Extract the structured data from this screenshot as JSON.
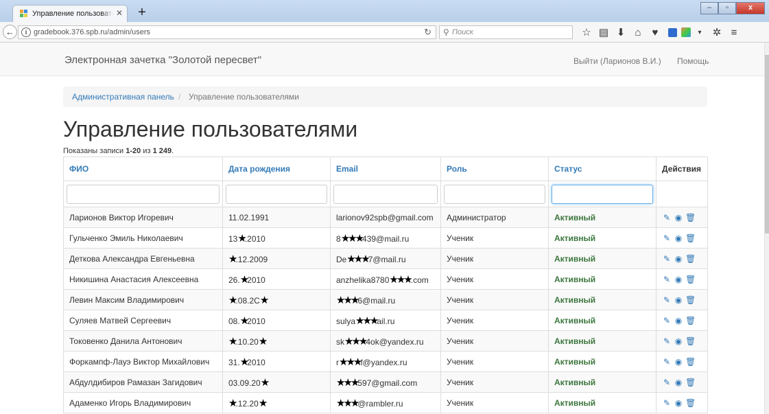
{
  "browser": {
    "tab_title": "Управление пользователям",
    "url": "gradebook.376.spb.ru/admin/users",
    "search_placeholder": "Поиск"
  },
  "app": {
    "brand": "Электронная зачетка \"Золотой пересвет\"",
    "logout": "Выйти (Ларионов В.И.)",
    "help": "Помощь"
  },
  "breadcrumb": {
    "parent": "Административная панель",
    "separator": "/",
    "current": "Управление пользователями"
  },
  "page": {
    "title": "Управление пользователями",
    "summary_prefix": "Показаны записи",
    "summary_range": "1-20",
    "summary_of": "из",
    "summary_total": "1 249",
    "summary_end": "."
  },
  "table": {
    "headers": [
      "ФИО",
      "Дата рождения",
      "Email",
      "Роль",
      "Статус",
      "Действия"
    ],
    "rows": [
      [
        "Ларионов Виктор Игоревич",
        "11.02.1991",
        "larionov92spb@gmail.com",
        "Администратор",
        "Активный"
      ],
      [
        "Гульченко Эмиль Николаевич",
        "13★.2010",
        "8★★★439@mail.ru",
        "Ученик",
        "Активный"
      ],
      [
        "Деткова Александра Евгеньевна",
        "★.12.2009",
        "De★★★7@mail.ru",
        "Ученик",
        "Активный"
      ],
      [
        "Никишина Анастасия Алексеевна",
        "26.★2010",
        "anzhelika8780★★★.com",
        "Ученик",
        "Активный"
      ],
      [
        "Левин Максим Владимирович",
        "★.08.2C★",
        "★★★6@mail.ru",
        "Ученик",
        "Активный"
      ],
      [
        "Суляев Матвей Сергеевич",
        "08.★2010",
        "sulya★★★ail.ru",
        "Ученик",
        "Активный"
      ],
      [
        "Токовенко Данила Антонович",
        "★.10.20★",
        "sk★★★4ok@yandex.ru",
        "Ученик",
        "Активный"
      ],
      [
        "Форкампф-Лауэ Виктор Михайлович",
        "31.★2010",
        "r★★★f@yandex.ru",
        "Ученик",
        "Активный"
      ],
      [
        "Абдулдибиров Рамазан Загидович",
        "03.09.20★",
        "★★★597@gmail.com",
        "Ученик",
        "Активный"
      ],
      [
        "Адаменко Игорь Владимирович",
        "★.12.20★",
        "★★★@rambler.ru",
        "Ученик",
        "Активный"
      ]
    ]
  },
  "icons": {
    "edit": "pencil-icon",
    "view": "eye-icon",
    "delete": "trash-icon"
  },
  "colors": {
    "link": "#337ab7",
    "status_active": "#3c763d",
    "breadcrumb_bg": "#f5f5f5"
  }
}
